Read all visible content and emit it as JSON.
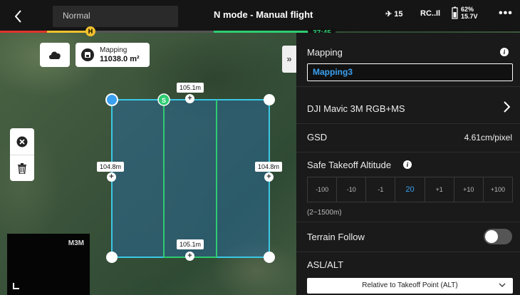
{
  "header": {
    "mode": "Normal",
    "title": "N mode - Manual flight",
    "gps_count": "15",
    "rc_label": "RC..Il",
    "battery_percent": "62%",
    "battery_voltage": "15.7V",
    "more": "•••",
    "flight_time": "37:45",
    "home_marker": "H"
  },
  "map_overlay": {
    "mapping_label": "Mapping",
    "mapping_area": "11038.0 m²",
    "expand_label": "»",
    "start_marker": "S",
    "dimensions": {
      "top": "105.1m",
      "bottom": "105.1m",
      "left": "104.8m",
      "right": "104.8m"
    },
    "camera_label": "M3M"
  },
  "panel": {
    "section_title": "Mapping",
    "route_name": "Mapping3",
    "camera": "DJI Mavic 3M RGB+MS",
    "gsd_label": "GSD",
    "gsd_value": "4.61cm/pixel",
    "safe_takeoff_label": "Safe Takeoff Altitude",
    "altitude_buttons": [
      "-100",
      "-10",
      "-1",
      "20",
      "+1",
      "+10",
      "+100"
    ],
    "altitude_selected": "20",
    "altitude_range": "(2~1500m)",
    "terrain_follow_label": "Terrain Follow",
    "terrain_follow_on": false,
    "asl_alt_label": "ASL/ALT",
    "asl_alt_value": "Relative to Takeoff Point (ALT)"
  },
  "icons": [
    "back-icon",
    "satellite-icon",
    "battery-icon",
    "cloud-icon",
    "save-icon",
    "close-icon",
    "trash-icon",
    "info-icon",
    "chevron-right-icon",
    "chevron-down-icon",
    "plus-icon"
  ],
  "colors": {
    "accent_blue": "#3aa0f0",
    "boundary_cyan": "#3bc8e6",
    "start_green": "#2ecc71",
    "home_yellow": "#f2c12e",
    "warning_red": "#e0342c"
  }
}
